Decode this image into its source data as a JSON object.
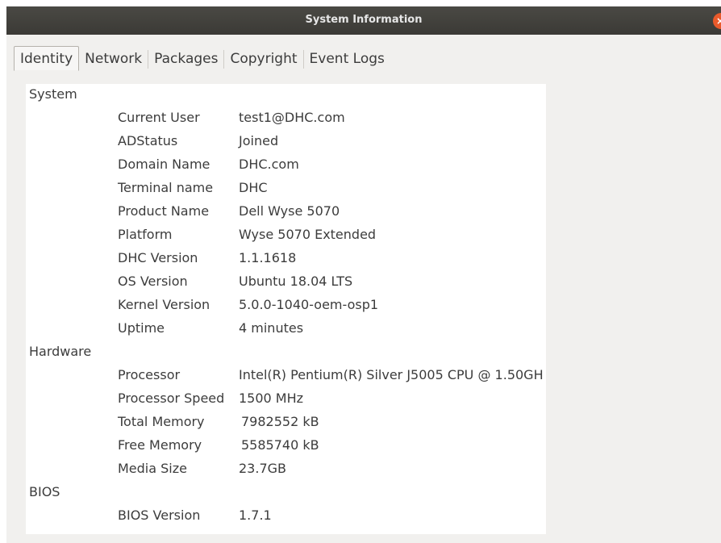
{
  "window": {
    "title": "System Information",
    "close_label": "×"
  },
  "tabs": [
    {
      "label": "Identity",
      "active": true
    },
    {
      "label": "Network",
      "active": false
    },
    {
      "label": "Packages",
      "active": false
    },
    {
      "label": "Copyright",
      "active": false
    },
    {
      "label": "Event Logs",
      "active": false
    }
  ],
  "identity": {
    "system": {
      "heading": "System",
      "rows": [
        {
          "label": "Current User",
          "value": "test1@DHC.com"
        },
        {
          "label": "ADStatus",
          "value": "Joined"
        },
        {
          "label": "Domain Name",
          "value": "DHC.com"
        },
        {
          "label": "Terminal name",
          "value": "DHC"
        },
        {
          "label": "Product Name",
          "value": "Dell Wyse 5070"
        },
        {
          "label": "Platform",
          "value": "Wyse 5070 Extended"
        },
        {
          "label": "DHC Version",
          "value": "1.1.1618"
        },
        {
          "label": "OS Version",
          "value": "Ubuntu 18.04 LTS"
        },
        {
          "label": "Kernel Version",
          "value": "5.0.0-1040-oem-osp1"
        },
        {
          "label": "Uptime",
          "value": "4 minutes"
        }
      ]
    },
    "hardware": {
      "heading": "Hardware",
      "rows": [
        {
          "label": "Processor",
          "value": "Intel(R) Pentium(R) Silver J5005 CPU @ 1.50GH"
        },
        {
          "label": "Processor Speed",
          "value": "1500 MHz"
        },
        {
          "label": "Total Memory",
          "value": "7982552 kB"
        },
        {
          "label": "Free Memory",
          "value": "5585740 kB"
        },
        {
          "label": "Media Size",
          "value": "23.7GB"
        }
      ]
    },
    "bios": {
      "heading": "BIOS",
      "rows": [
        {
          "label": "BIOS Version",
          "value": "1.7.1"
        }
      ]
    }
  }
}
